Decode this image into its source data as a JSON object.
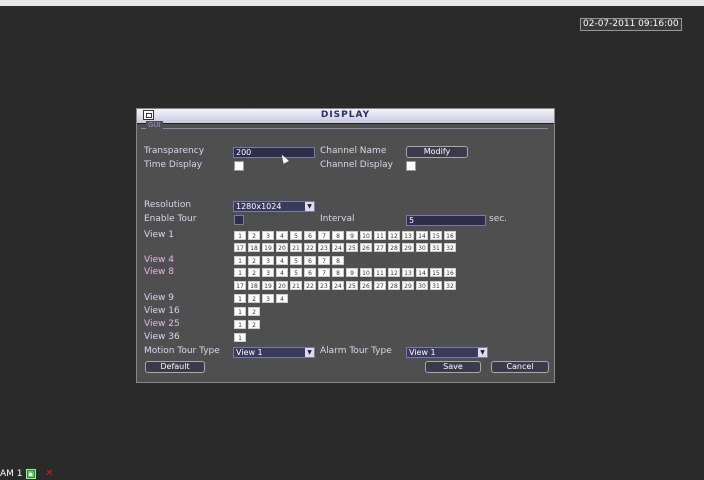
{
  "clock": "02-07-2011 09:16:00",
  "status_bar": {
    "channel_label": "AM 1"
  },
  "dialog": {
    "title": "DISPLAY",
    "tab": "GUI",
    "transparency": {
      "label": "Transparency",
      "value": "200"
    },
    "channel_name": {
      "label": "Channel Name",
      "button": "Modify"
    },
    "time_display": {
      "label": "Time Display",
      "checked": true
    },
    "channel_display": {
      "label": "Channel Display",
      "checked": true
    },
    "resolution": {
      "label": "Resolution",
      "value": "1280x1024"
    },
    "enable_tour": {
      "label": "Enable Tour",
      "checked": false
    },
    "interval": {
      "label": "Interval",
      "value": "5",
      "unit": "sec."
    },
    "views": {
      "view1": {
        "label": "View 1",
        "row1": [
          "1",
          "2",
          "3",
          "4",
          "5",
          "6",
          "7",
          "8",
          "9",
          "10",
          "11",
          "12",
          "13",
          "14",
          "15",
          "16"
        ],
        "row2": [
          "17",
          "18",
          "19",
          "20",
          "21",
          "22",
          "23",
          "24",
          "25",
          "26",
          "27",
          "28",
          "29",
          "30",
          "31",
          "32"
        ]
      },
      "view4": {
        "label": "View 4",
        "row1": [
          "1",
          "2",
          "3",
          "4",
          "5",
          "6",
          "7",
          "8"
        ]
      },
      "view8": {
        "label": "View 8",
        "row1": [
          "1",
          "2",
          "3",
          "4",
          "5",
          "6",
          "7",
          "8",
          "9",
          "10",
          "11",
          "12",
          "13",
          "14",
          "15",
          "16"
        ],
        "row2": [
          "17",
          "18",
          "19",
          "20",
          "21",
          "22",
          "23",
          "24",
          "25",
          "26",
          "27",
          "28",
          "29",
          "30",
          "31",
          "32"
        ]
      },
      "view9": {
        "label": "View 9",
        "row1": [
          "1",
          "2",
          "3",
          "4"
        ]
      },
      "view16": {
        "label": "View 16",
        "row1": [
          "1",
          "2"
        ]
      },
      "view25": {
        "label": "View 25",
        "row1": [
          "1",
          "2"
        ]
      },
      "view36": {
        "label": "View 36",
        "row1": [
          "1"
        ]
      }
    },
    "motion_tour_type": {
      "label": "Motion Tour Type",
      "value": "View 1"
    },
    "alarm_tour_type": {
      "label": "Alarm Tour Type",
      "value": "View 1"
    },
    "buttons": {
      "default": "Default",
      "save": "Save",
      "cancel": "Cancel"
    }
  }
}
